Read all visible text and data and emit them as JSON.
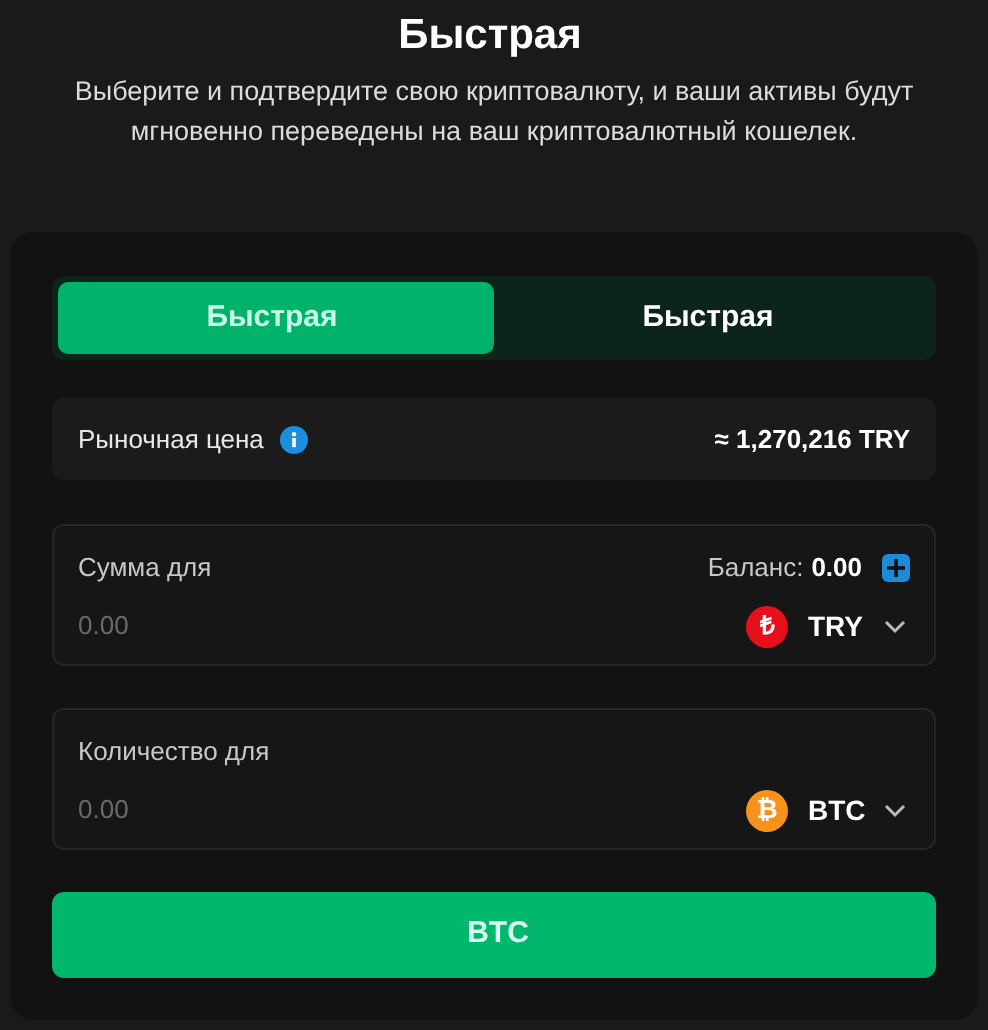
{
  "header": {
    "title": "Быстрая",
    "subtitle": "Выберите и подтвердите свою криптовалюту, и ваши активы будут мгновенно переведены на ваш криптовалютный кошелек."
  },
  "tabs": [
    {
      "label": "Быстрая",
      "selected": true
    },
    {
      "label": "Быстрая",
      "selected": false
    }
  ],
  "market": {
    "label": "Рыночная цена",
    "value": "≈ 1,270,216 TRY"
  },
  "fields": [
    {
      "label": "Сумма для",
      "balance_label": "Баланс:",
      "balance_value": "0.00",
      "placeholder": "0.00",
      "coin_glyph": "₺",
      "color": "#e5101a",
      "currency": "TRY"
    },
    {
      "label": "Количество для",
      "placeholder": "0.00",
      "coin_glyph": "₿",
      "color": "#f7931a",
      "currency": "BTC"
    }
  ],
  "submit": {
    "label": "BTC"
  }
}
